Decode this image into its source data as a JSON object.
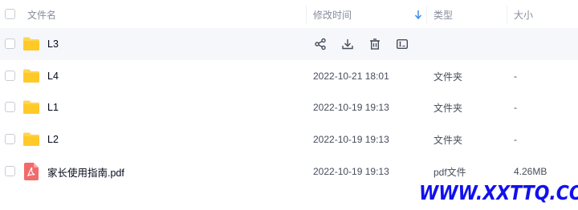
{
  "header": {
    "name_label": "文件名",
    "time_label": "修改时间",
    "type_label": "类型",
    "size_label": "大小"
  },
  "rows": [
    {
      "name": "L3",
      "icon": "folder-icon",
      "time": "",
      "type": "",
      "size": "",
      "hovered": true
    },
    {
      "name": "L4",
      "icon": "folder-icon",
      "time": "2022-10-21 18:01",
      "type": "文件夹",
      "size": "-"
    },
    {
      "name": "L1",
      "icon": "folder-icon",
      "time": "2022-10-19 19:13",
      "type": "文件夹",
      "size": "-"
    },
    {
      "name": "L2",
      "icon": "folder-icon",
      "time": "2022-10-19 19:13",
      "type": "文件夹",
      "size": "-"
    },
    {
      "name": "家长使用指南.pdf",
      "icon": "pdf-icon",
      "time": "2022-10-19 19:13",
      "type": "pdf文件",
      "size": "4.26MB"
    }
  ],
  "row_actions": [
    "share-icon",
    "download-icon",
    "delete-icon",
    "rename-icon"
  ],
  "watermark": "WWW.XXTTQ.COM",
  "colors": {
    "folder": "#ffd54f",
    "pdf": "#f26b6b",
    "sort_accent": "#3a8af2",
    "watermark": "#1111ee"
  }
}
